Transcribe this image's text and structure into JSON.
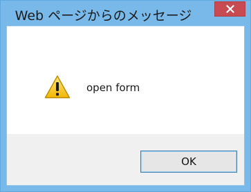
{
  "window": {
    "title": "Web ページからのメッセージ",
    "close_icon": "close-icon"
  },
  "dialog": {
    "icon": "warning-icon",
    "message": "open form",
    "ok_label": "OK"
  },
  "colors": {
    "titlebar": "#78b9ea",
    "close_button": "#c74b50",
    "footer": "#f0f0f0",
    "button_border": "#3c7fb1"
  }
}
